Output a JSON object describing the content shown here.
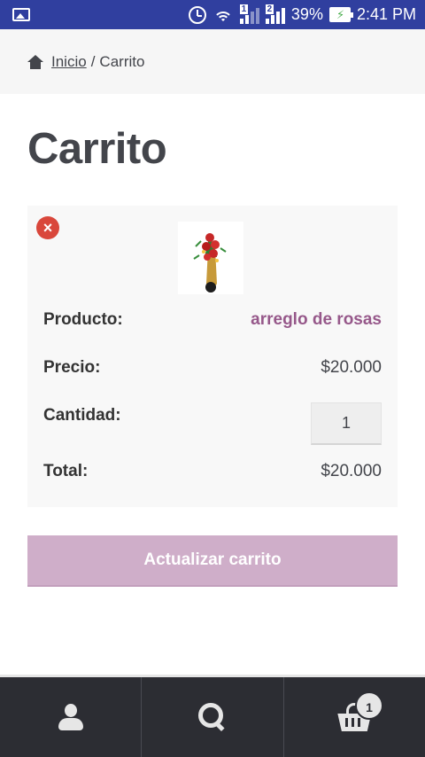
{
  "status_bar": {
    "battery": "39%",
    "time": "2:41 PM",
    "sim1": "1",
    "sim2": "2"
  },
  "breadcrumb": {
    "home": "Inicio",
    "separator": "/",
    "current": "Carrito"
  },
  "page": {
    "title": "Carrito"
  },
  "cart": {
    "remove_glyph": "×",
    "product_label": "Producto:",
    "product_name": "arreglo de rosas",
    "price_label": "Precio:",
    "price_value": "$20.000",
    "quantity_label": "Cantidad:",
    "quantity_value": "1",
    "total_label": "Total:",
    "total_value": "$20.000"
  },
  "actions": {
    "update_label": "Actualizar carrito"
  },
  "bottom_nav": {
    "cart_count": "1",
    "icons": [
      "account-icon",
      "search-icon",
      "basket-icon"
    ]
  },
  "colors": {
    "status_bar": "#303f9f",
    "accent": "#96588a",
    "button_disabled": "#cfaec9",
    "remove": "#d9473b",
    "nav_bg": "#2c2d33"
  }
}
